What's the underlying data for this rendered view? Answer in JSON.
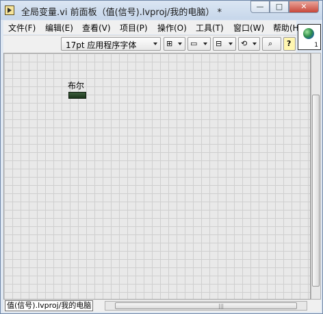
{
  "window": {
    "title": "全局变量.vi 前面板（值(信号).lvproj/我的电脑） *",
    "min_glyph": "—",
    "max_glyph": "□",
    "close_glyph": "✕"
  },
  "menu": {
    "items": [
      "文件(F)",
      "编辑(E)",
      "查看(V)",
      "项目(P)",
      "操作(O)",
      "工具(T)",
      "窗口(W)",
      "帮助(H)"
    ]
  },
  "toolbar": {
    "font_label": "17pt 应用程序字体",
    "align_icon": "align-objects-icon",
    "distribute_icon": "distribute-objects-icon",
    "resize_icon": "resize-objects-icon",
    "reorder_icon": "reorder-icon",
    "search_icon": "search-icon",
    "help_glyph": "?"
  },
  "vi_icon": {
    "number": "1"
  },
  "panel": {
    "boolean_label": "布尔"
  },
  "status": {
    "context": "值(信号).lvproj/我的电脑",
    "hscroll_grip": "|||"
  }
}
